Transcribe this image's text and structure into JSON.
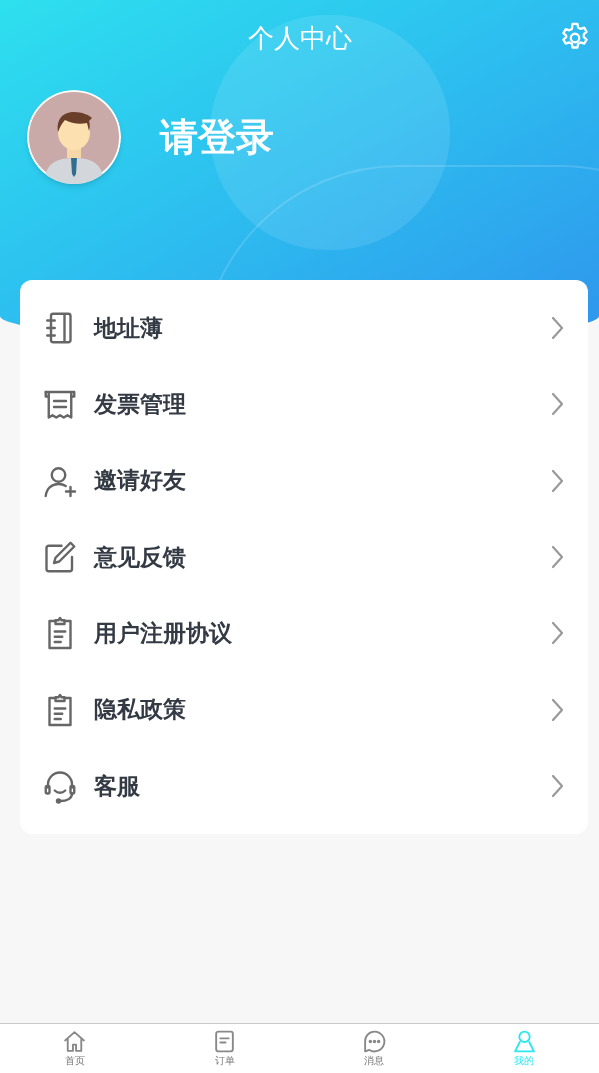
{
  "header": {
    "title": "个人中心",
    "login_text": "请登录"
  },
  "menu": [
    {
      "kind": "notebook",
      "label": "地址薄"
    },
    {
      "kind": "receipt",
      "label": "发票管理"
    },
    {
      "kind": "user-add",
      "label": "邀请好友"
    },
    {
      "kind": "edit",
      "label": "意见反馈"
    },
    {
      "kind": "clipboard",
      "label": "用户注册协议"
    },
    {
      "kind": "clipboard",
      "label": "隐私政策"
    },
    {
      "kind": "headset",
      "label": "客服"
    }
  ],
  "tab_bar": [
    {
      "kind": "home",
      "label": "首页",
      "selected": false
    },
    {
      "kind": "order",
      "label": "订单",
      "selected": false
    },
    {
      "kind": "message",
      "label": "消息",
      "selected": false
    },
    {
      "kind": "profile",
      "label": "我的",
      "selected": true
    }
  ]
}
